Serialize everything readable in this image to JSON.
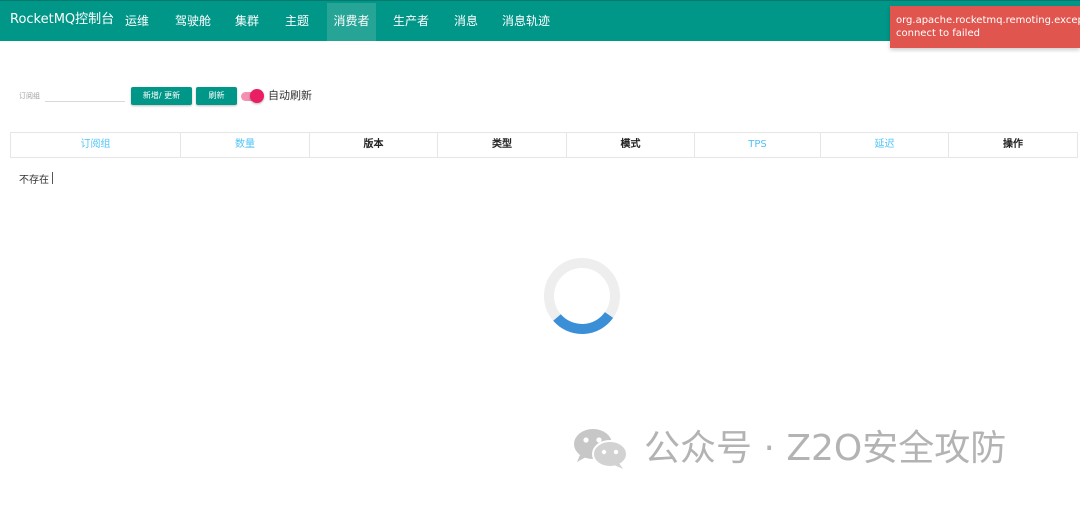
{
  "navbar": {
    "brand": "RocketMQ控制台",
    "items": [
      {
        "label": "运维",
        "active": false
      },
      {
        "label": "驾驶舱",
        "active": false
      },
      {
        "label": "集群",
        "active": false
      },
      {
        "label": "主题",
        "active": false
      },
      {
        "label": "消费者",
        "active": true
      },
      {
        "label": "生产者",
        "active": false
      },
      {
        "label": "消息",
        "active": false
      },
      {
        "label": "消息轨迹",
        "active": false
      }
    ]
  },
  "toast": {
    "line1": "org.apache.rocketmq.remoting.exception.",
    "line2": "connect to failed",
    "color": "#e0564f"
  },
  "filter": {
    "label": "订阅组",
    "input_value": "",
    "add_button": "新增/ 更新",
    "refresh_button": "刷新",
    "auto_refresh_label": "自动刷新",
    "auto_refresh_on": true
  },
  "table": {
    "columns": [
      {
        "label": "订阅组",
        "sortable": true
      },
      {
        "label": "数量",
        "sortable": true
      },
      {
        "label": "版本",
        "sortable": false
      },
      {
        "label": "类型",
        "sortable": false
      },
      {
        "label": "模式",
        "sortable": false
      },
      {
        "label": "TPS",
        "sortable": true
      },
      {
        "label": "延迟",
        "sortable": true
      },
      {
        "label": "操作",
        "sortable": false
      }
    ],
    "empty_text": "不存在"
  },
  "loading": {
    "spinner_icon": "loading-spinner-icon"
  },
  "watermark": {
    "icon": "wechat-icon",
    "text": "公众号 · Z2O安全攻防"
  },
  "colors": {
    "primary": "#009688",
    "primary_active": "#26a596",
    "toast_error": "#e0564f",
    "toggle_on": "#e91e63",
    "link_header": "#4fc3f7",
    "spinner": "#3a8fd6"
  }
}
